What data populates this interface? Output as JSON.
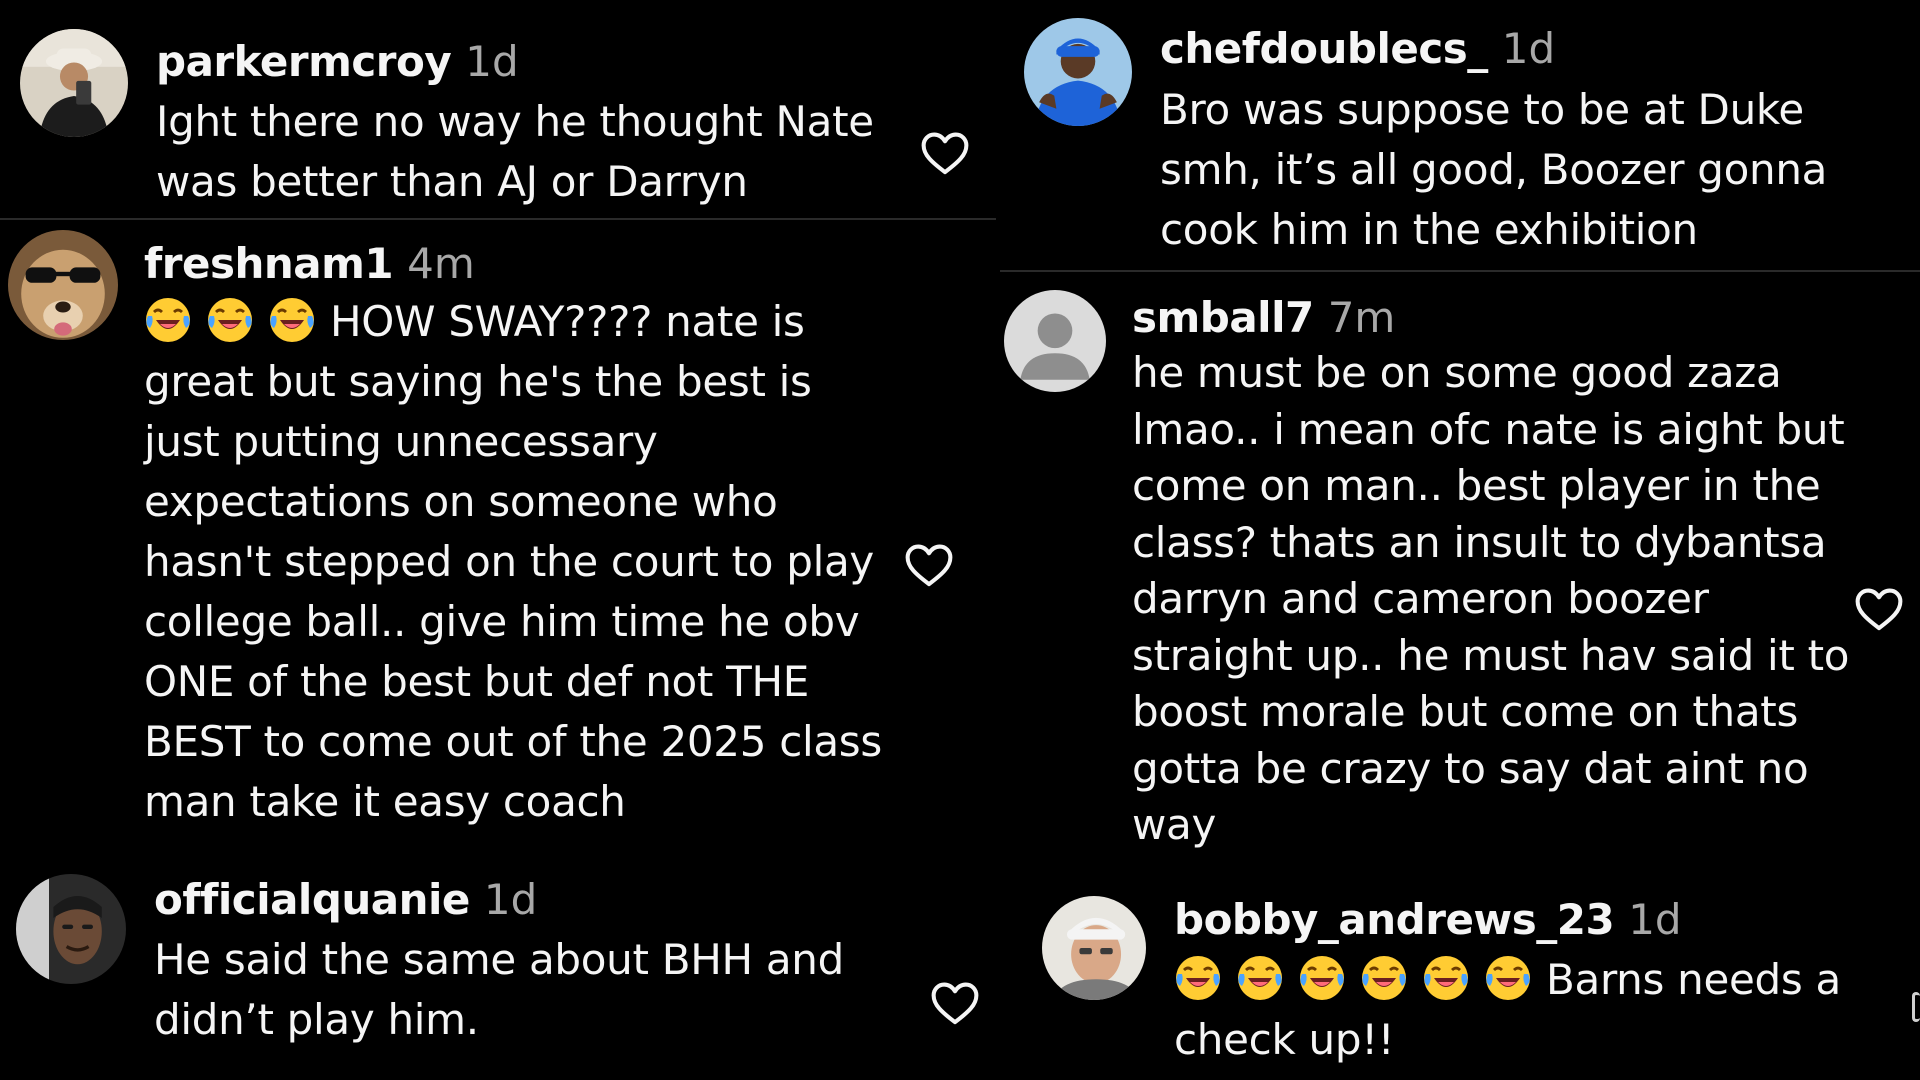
{
  "comments": {
    "parkermcroy": {
      "username": "parkermcroy",
      "time": "1d",
      "lines": [
        "Ight there no way he thought Nate",
        "was better than AJ or Darryn"
      ],
      "like_icon": "heart-outline-icon"
    },
    "chefdoublecs": {
      "username": "chefdoublecs_",
      "time": "1d",
      "lines": [
        "Bro was suppose to be at Duke",
        "smh, it’s all good, Boozer gonna",
        "cook him in the exhibition"
      ],
      "like_icon": "heart-outline-icon"
    },
    "freshnam1": {
      "username": "freshnam1",
      "time": "4m",
      "first_line_text": "HOW SWAY???? nate is",
      "lines": [
        "great but saying he's the best is",
        "just putting unnecessary",
        "expectations on someone who",
        "hasn't stepped on the court to play",
        "college ball.. give him time he obv",
        "ONE of the best but def not THE",
        "BEST to come out of the 2025 class",
        "man take it easy coach"
      ],
      "emoji": "face-with-tears-of-joy",
      "emoji_count": 3,
      "like_icon": "heart-outline-icon"
    },
    "smball7": {
      "username": "smball7",
      "time": "7m",
      "lines": [
        "he must be on some good zaza",
        "lmao.. i mean ofc nate is aight but",
        "come on man.. best player in the",
        "class? thats an insult to dybantsa",
        "darryn and cameron boozer",
        "straight up.. he must hav said it to",
        "boost morale but come on thats",
        "gotta be crazy to say dat aint no",
        "way"
      ],
      "like_icon": "heart-outline-icon"
    },
    "officialquanie": {
      "username": "officialquanie",
      "time": "1d",
      "lines": [
        "He said the same about BHH and",
        "didn’t play him."
      ],
      "like_icon": "heart-outline-icon"
    },
    "bobby_andrews_23": {
      "username": "bobby_andrews_23",
      "time": "1d",
      "first_line_text": "Barns needs a",
      "lines": [
        "check up!!"
      ],
      "emoji": "face-with-tears-of-joy",
      "emoji_count": 6,
      "like_icon": "heart-outline-icon"
    }
  },
  "colors": {
    "background": "#000000",
    "text_primary": "#f5f5f5",
    "text_secondary": "#a8a8a8",
    "divider": "#2a2a2a",
    "emoji_face": "#ffcc33",
    "emoji_tear": "#4aa3ff"
  }
}
